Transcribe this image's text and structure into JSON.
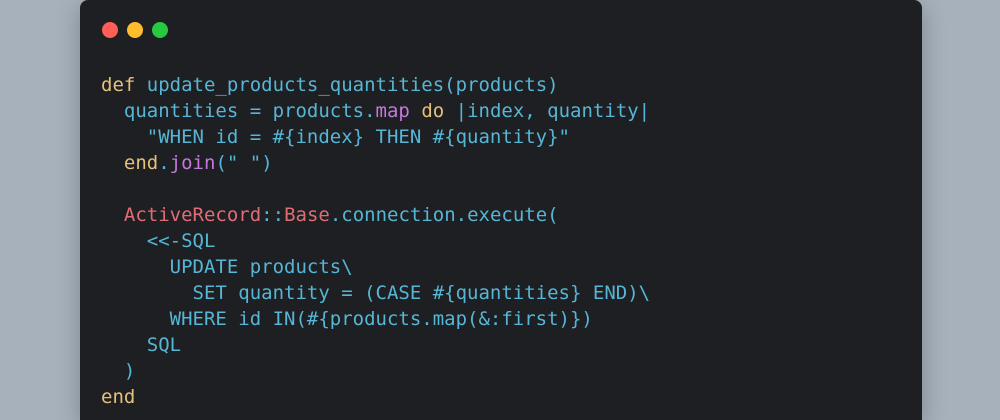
{
  "window": {
    "buttons": [
      {
        "name": "close-button",
        "color": "#ff5f56"
      },
      {
        "name": "minimize-button",
        "color": "#ffbd2e"
      },
      {
        "name": "maximize-button",
        "color": "#27c93f"
      }
    ]
  },
  "colors": {
    "keyword": "#e5c07b",
    "identifier": "#56b6d6",
    "method": "#c678dd",
    "constant": "#e06c75",
    "string": "#56b6d6",
    "plain": "#abb2bf"
  },
  "code": {
    "lines": [
      [
        {
          "t": "def",
          "c": "keyword"
        },
        {
          "t": " update_products_quantities(products)",
          "c": "identifier"
        }
      ],
      [
        {
          "t": "  quantities = products.",
          "c": "identifier"
        },
        {
          "t": "map",
          "c": "method"
        },
        {
          "t": " ",
          "c": "plain"
        },
        {
          "t": "do",
          "c": "keyword"
        },
        {
          "t": " |index, quantity|",
          "c": "identifier"
        }
      ],
      [
        {
          "t": "    \"WHEN id = #{index} THEN #{quantity}\"",
          "c": "string"
        }
      ],
      [
        {
          "t": "  ",
          "c": "plain"
        },
        {
          "t": "end",
          "c": "keyword"
        },
        {
          "t": ".",
          "c": "identifier"
        },
        {
          "t": "join",
          "c": "method"
        },
        {
          "t": "(\" \")",
          "c": "identifier"
        }
      ],
      [
        {
          "t": "",
          "c": "plain"
        }
      ],
      [
        {
          "t": "  ",
          "c": "plain"
        },
        {
          "t": "ActiveRecord",
          "c": "constant"
        },
        {
          "t": "::",
          "c": "identifier"
        },
        {
          "t": "Base",
          "c": "constant"
        },
        {
          "t": ".connection.execute(",
          "c": "identifier"
        }
      ],
      [
        {
          "t": "    <<-SQL",
          "c": "string"
        }
      ],
      [
        {
          "t": "      UPDATE products\\",
          "c": "string"
        }
      ],
      [
        {
          "t": "        SET quantity = (CASE #{quantities} END)\\",
          "c": "string"
        }
      ],
      [
        {
          "t": "      WHERE id IN(#{products.map(&:first)})",
          "c": "string"
        }
      ],
      [
        {
          "t": "    SQL",
          "c": "string"
        }
      ],
      [
        {
          "t": "  )",
          "c": "identifier"
        }
      ],
      [
        {
          "t": "end",
          "c": "keyword"
        }
      ]
    ]
  }
}
